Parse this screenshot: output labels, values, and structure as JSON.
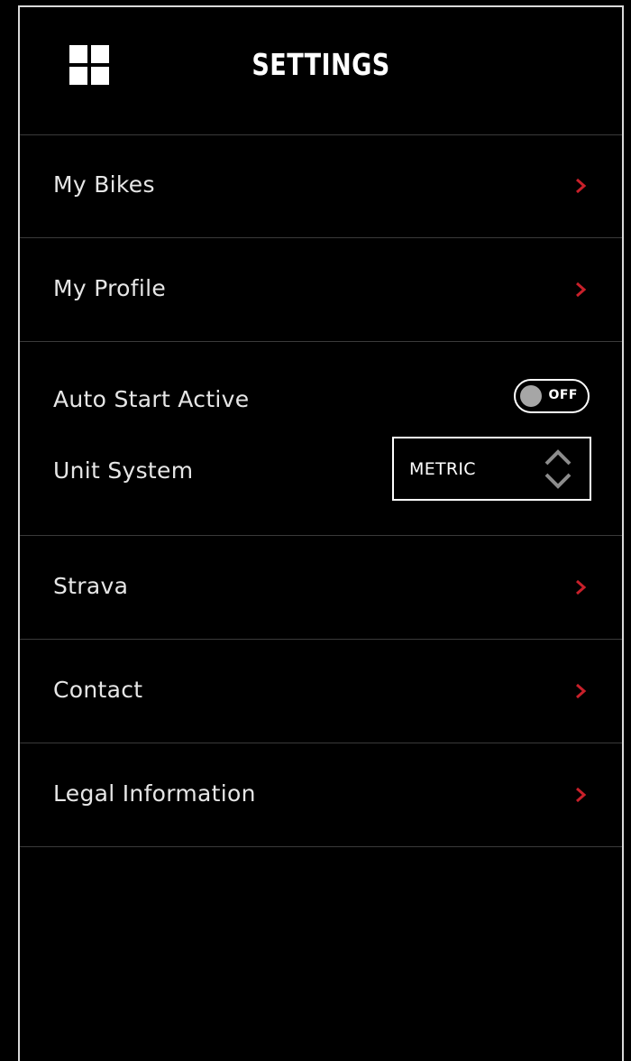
{
  "header": {
    "title": "SETTINGS",
    "menu_icon": "grid-menu-icon"
  },
  "menu_items": [
    {
      "label": "My Bikes",
      "icon": "chevron-right-icon"
    },
    {
      "label": "My Profile",
      "icon": "chevron-right-icon"
    }
  ],
  "preferences": {
    "auto_start_label": "Auto Start Active",
    "auto_start_state": "OFF",
    "unit_system_label": "Unit System",
    "unit_system_value": "METRIC",
    "unit_system_icon": "up-down-arrows-icon"
  },
  "links": [
    {
      "label": "Strava",
      "icon": "chevron-right-icon"
    },
    {
      "label": "Contact",
      "icon": "chevron-right-icon"
    },
    {
      "label": "Legal Information",
      "icon": "chevron-right-icon"
    }
  ],
  "colors": {
    "background": "#000000",
    "accent": "#c8202a",
    "divider": "#3a3a3a",
    "text": "#e6e6e6"
  }
}
